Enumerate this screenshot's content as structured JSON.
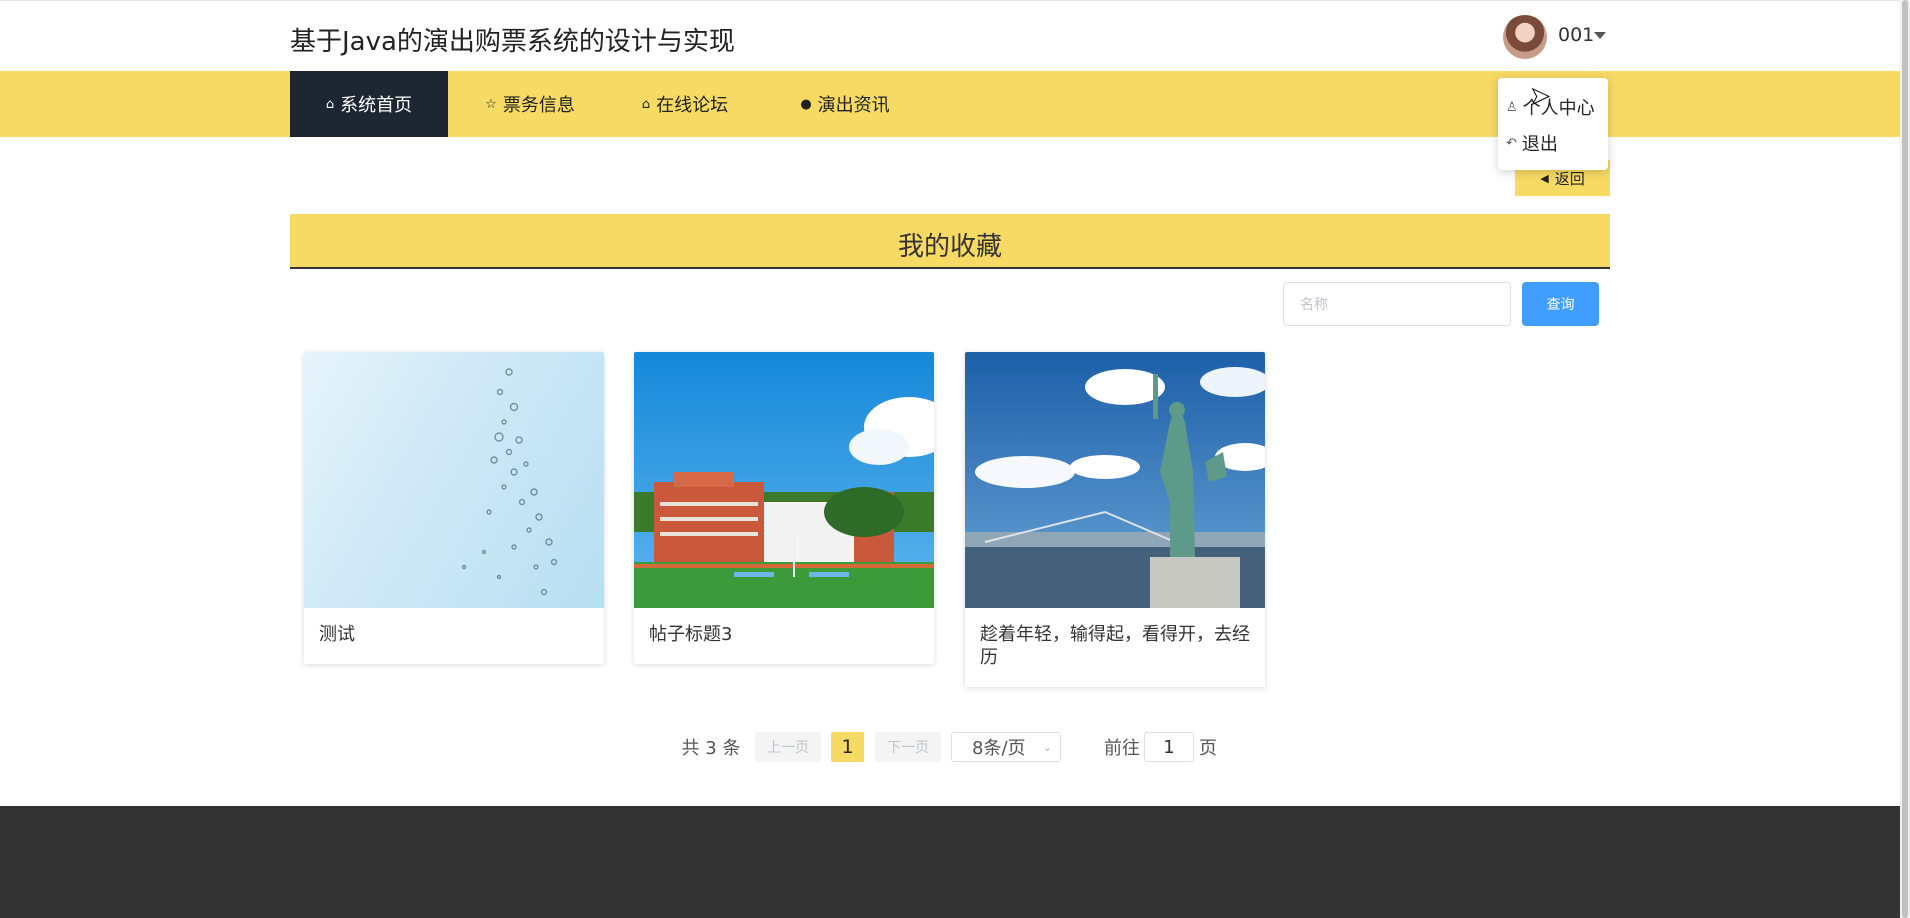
{
  "header": {
    "title": "基于Java的演出购票系统的设计与实现",
    "username": "001"
  },
  "nav": {
    "items": [
      {
        "label": "系统首页",
        "icon": "home-icon",
        "active": true
      },
      {
        "label": "票务信息",
        "icon": "star-icon",
        "active": false
      },
      {
        "label": "在线论坛",
        "icon": "bag-icon",
        "active": false
      },
      {
        "label": "演出资讯",
        "icon": "info-icon",
        "active": false
      }
    ]
  },
  "user_menu": {
    "items": [
      {
        "label": "个人中心",
        "icon": "user-icon"
      },
      {
        "label": "退出",
        "icon": "logout-icon"
      }
    ]
  },
  "back_label": "返回",
  "section_title": "我的收藏",
  "search": {
    "placeholder": "名称",
    "button_label": "查询"
  },
  "cards": [
    {
      "title": "测试",
      "image": "water-drops-image"
    },
    {
      "title": "帖子标题3",
      "image": "school-building-image"
    },
    {
      "title": "趁着年轻，输得起，看得开，去经历",
      "image": "statue-of-liberty-image"
    }
  ],
  "pagination": {
    "total_text": "共 3 条",
    "prev_label": "上一页",
    "current_page": "1",
    "next_label": "下一页",
    "page_size": "8条/页",
    "goto_prefix": "前往",
    "goto_value": "1",
    "goto_suffix": "页"
  },
  "colors": {
    "accent": "#f6da64",
    "nav_active": "#1c2733",
    "search_button": "#409eff",
    "footer": "#333333"
  }
}
